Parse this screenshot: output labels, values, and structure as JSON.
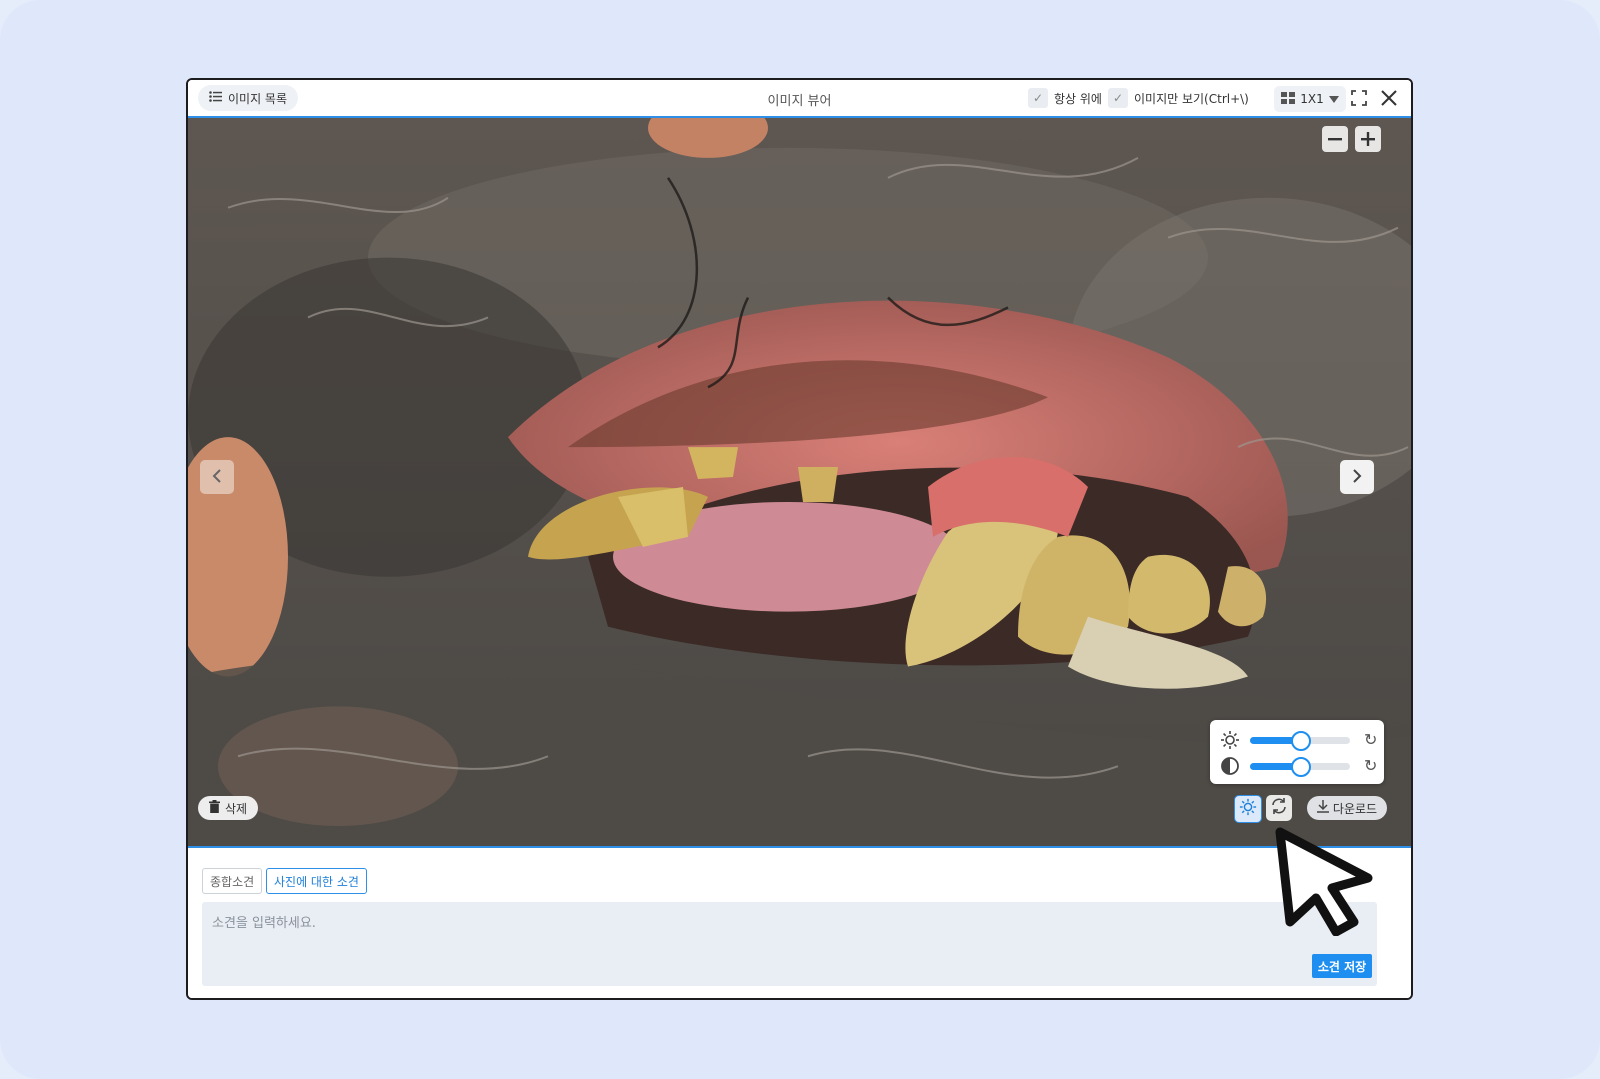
{
  "titlebar": {
    "image_list_label": "이미지 목록",
    "title": "이미지 뷰어",
    "always_on_top_label": "항상 위에",
    "image_only_label": "이미지만 보기(Ctrl+\\)",
    "layout_label": "1X1"
  },
  "viewer": {
    "brightness_level_percent": 50,
    "contrast_level_percent": 50,
    "delete_label": "삭제",
    "download_label": "다운로드"
  },
  "bottom": {
    "tab_overall": "종합소견",
    "tab_photo": "사진에 대한 소견",
    "memo_placeholder": "소견을 입력하세요.",
    "save_label": "소견 저장"
  },
  "colors": {
    "accent": "#1e8ff0",
    "border": "#2e8fe8",
    "background": "#dfe8fb"
  }
}
